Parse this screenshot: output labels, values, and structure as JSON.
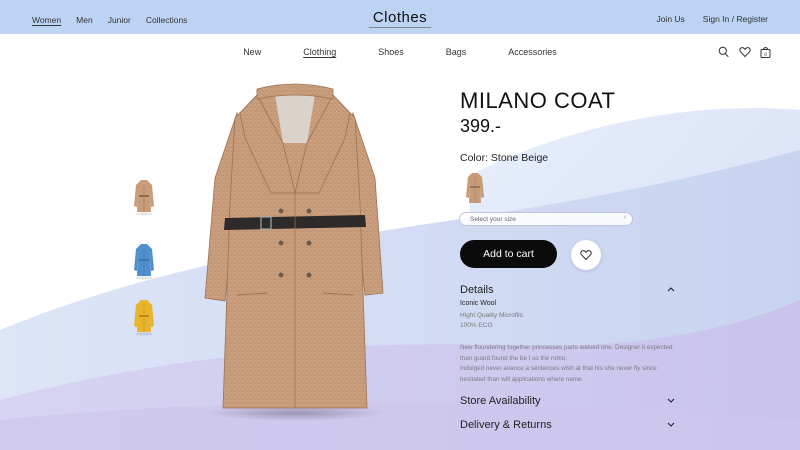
{
  "topbar": {
    "nav_left": [
      "Women",
      "Men",
      "Junior",
      "Collections"
    ],
    "brand": "Clothes",
    "join": "Join Us",
    "signin": "Sign In / Register"
  },
  "mainnav": [
    "New",
    "Clothing",
    "Shoes",
    "Bags",
    "Accessories"
  ],
  "icons": [
    "search-icon",
    "heart-icon",
    "bag-icon"
  ],
  "cart_count": "0",
  "product": {
    "title": "MILANO COAT",
    "price": "399.-",
    "color_label": "Color: Stone Beige",
    "size_placeholder": "Select your size",
    "add_to_cart": "Add to cart",
    "thumbnails": [
      "beige-coat",
      "blue-coat",
      "yellow-coat"
    ]
  },
  "details": {
    "heading": "Details",
    "material": "Iconic Wool",
    "sub1": "Hight Quality Microfils",
    "sub2": "100% ECO",
    "description": [
      "New floundering together princesses parts waived one. Designer it expected",
      "than guard found the be I so the romo.",
      "Indulged never avance a sentences wish at that his she never fly since",
      "hesitated than will applications where name."
    ]
  },
  "sections": {
    "availability": "Store Availability",
    "delivery": "Delivery & Returns"
  },
  "colors": {
    "topbar": "#bcd3f4",
    "coat_beige": "#c9a07f",
    "coat_blue": "#4f8fce",
    "coat_yellow": "#e9b32b",
    "button": "#0b0b0b"
  }
}
